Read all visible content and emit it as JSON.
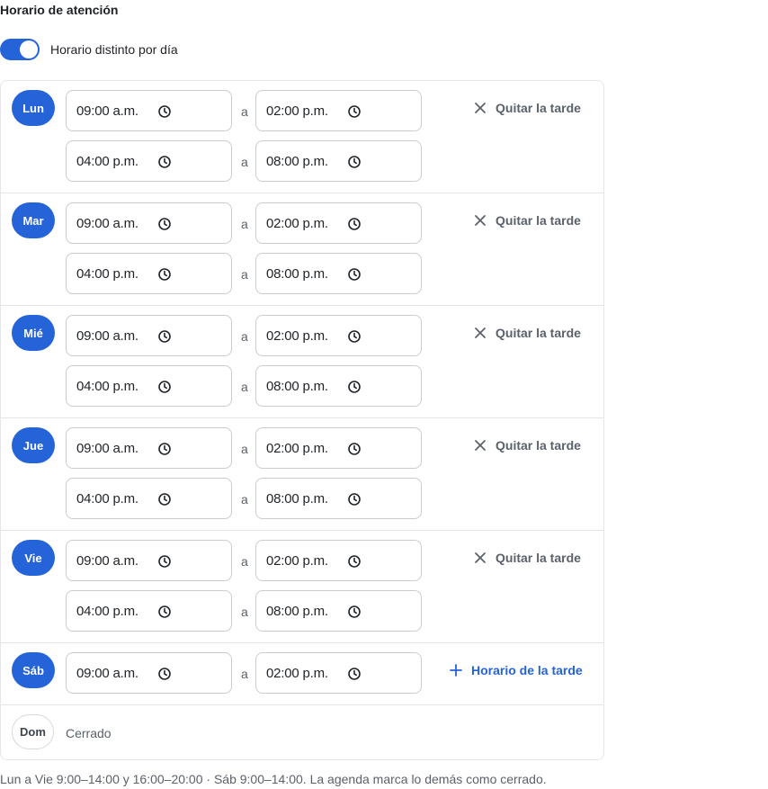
{
  "section_title": "Horario de atención",
  "toggle": {
    "label": "Horario distinto por día",
    "on": true
  },
  "separator": "a",
  "days": [
    {
      "day": "Lun",
      "morning": {
        "from": "09:00 a.m.",
        "to": "02:00 p.m."
      },
      "afternoon": {
        "from": "04:00 p.m.",
        "to": "08:00 p.m."
      },
      "action": "Quitar la tarde"
    },
    {
      "day": "Mar",
      "morning": {
        "from": "09:00 a.m.",
        "to": "02:00 p.m."
      },
      "afternoon": {
        "from": "04:00 p.m.",
        "to": "08:00 p.m."
      },
      "action": "Quitar la tarde"
    },
    {
      "day": "Mié",
      "morning": {
        "from": "09:00 a.m.",
        "to": "02:00 p.m."
      },
      "afternoon": {
        "from": "04:00 p.m.",
        "to": "08:00 p.m."
      },
      "action": "Quitar la tarde"
    },
    {
      "day": "Jue",
      "morning": {
        "from": "09:00 a.m.",
        "to": "02:00 p.m."
      },
      "afternoon": {
        "from": "04:00 p.m.",
        "to": "08:00 p.m."
      },
      "action": "Quitar la tarde"
    },
    {
      "day": "Vie",
      "morning": {
        "from": "09:00 a.m.",
        "to": "02:00 p.m."
      },
      "afternoon": {
        "from": "04:00 p.m.",
        "to": "08:00 p.m."
      },
      "action": "Quitar la tarde"
    },
    {
      "day": "Sáb",
      "morning": {
        "from": "09:00 a.m.",
        "to": "02:00 p.m."
      },
      "action": "Horario de la tarde"
    },
    {
      "day": "Dom",
      "status": "Cerrado"
    }
  ],
  "summary": "Lun a Vie 9:00–14:00 y 16:00–20:00 · Sáb 9:00–14:00. La agenda marca lo demás como cerrado.",
  "colors": {
    "accent": "#2563d8",
    "border": "#e3e5e8",
    "muted": "#5b616b"
  },
  "icons": {
    "clock": "clock-icon",
    "remove": "close-icon",
    "add": "plus-icon"
  }
}
